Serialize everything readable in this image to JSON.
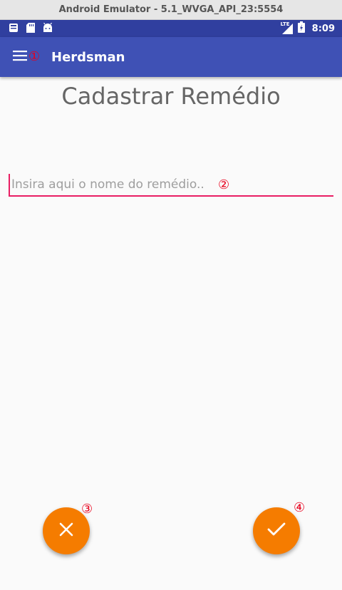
{
  "window": {
    "title": "Android Emulator - 5.1_WVGA_API_23:5554"
  },
  "status_bar": {
    "time": "8:09",
    "network": "LTE",
    "left_icons": [
      "notification-icon",
      "sd-card-icon",
      "android-icon"
    ],
    "right_icons": [
      "signal-icon",
      "battery-icon"
    ]
  },
  "app_bar": {
    "title": "Herdsman",
    "menu_icon": "menu-icon"
  },
  "page": {
    "title": "Cadastrar Remédio"
  },
  "form": {
    "name_field": {
      "value": "",
      "placeholder": "Insira aqui o nome do remédio.."
    }
  },
  "actions": {
    "cancel_icon": "close-icon",
    "confirm_icon": "check-icon"
  },
  "annotations": [
    "①",
    "②",
    "③",
    "④"
  ],
  "colors": {
    "status_bar": "#303f9f",
    "app_bar": "#3f51b5",
    "accent": "#e91e63",
    "fab": "#f57c00",
    "annotation": "#e8001c"
  }
}
